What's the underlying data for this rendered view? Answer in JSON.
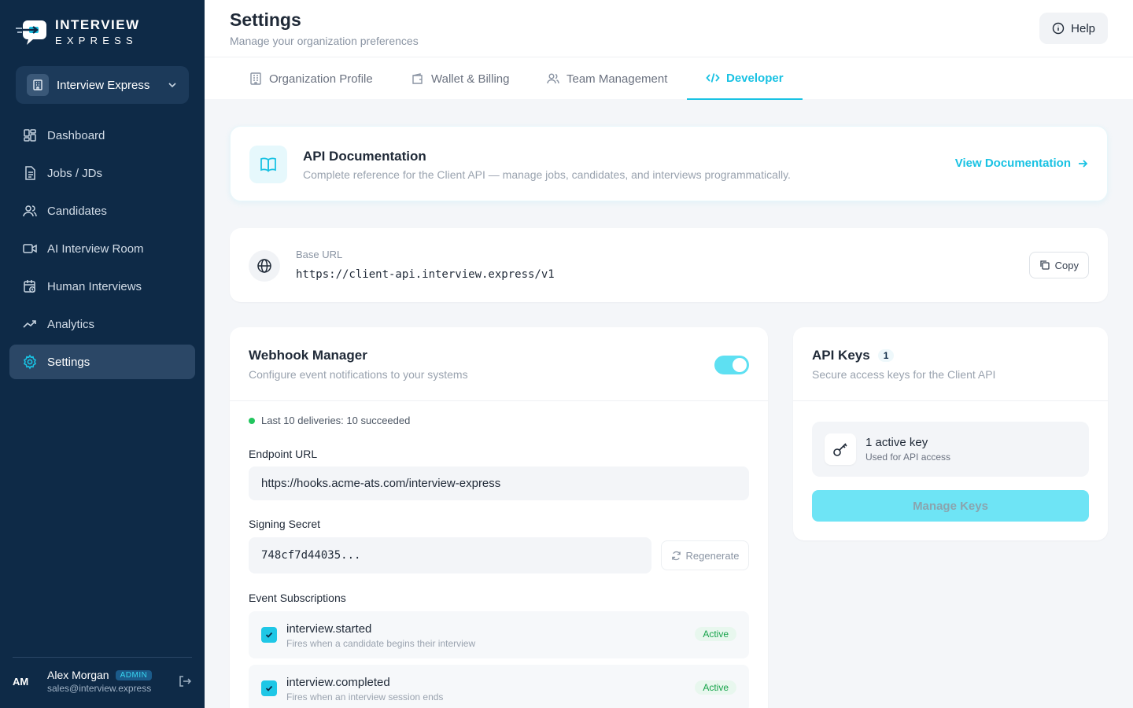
{
  "brand": {
    "line1": "INTERVIEW",
    "line2": "EXPRESS"
  },
  "org": {
    "label": "Interview Express"
  },
  "nav": [
    {
      "label": "Dashboard",
      "icon": "grid-icon"
    },
    {
      "label": "Jobs / JDs",
      "icon": "document-icon"
    },
    {
      "label": "Candidates",
      "icon": "users-icon"
    },
    {
      "label": "AI Interview Room",
      "icon": "video-icon"
    },
    {
      "label": "Human Interviews",
      "icon": "calendar-clock-icon"
    },
    {
      "label": "Analytics",
      "icon": "trend-icon"
    },
    {
      "label": "Settings",
      "icon": "gear-icon",
      "active": true
    }
  ],
  "user": {
    "initials": "AM",
    "name": "Alex Morgan",
    "role": "ADMIN",
    "email": "sales@interview.express"
  },
  "header": {
    "title": "Settings",
    "subtitle": "Manage your organization preferences",
    "help": "Help"
  },
  "tabs": [
    {
      "label": "Organization Profile"
    },
    {
      "label": "Wallet & Billing"
    },
    {
      "label": "Team Management"
    },
    {
      "label": "Developer",
      "active": true
    }
  ],
  "docs": {
    "title": "API Documentation",
    "description": "Complete reference for the Client API — manage jobs, candidates, and interviews programmatically.",
    "link": "View Documentation"
  },
  "base_url": {
    "label": "Base URL",
    "value": "https://client-api.interview.express/v1",
    "copy": "Copy"
  },
  "webhook": {
    "title": "Webhook Manager",
    "subtitle": "Configure event notifications to your systems",
    "enabled": true,
    "deliveries": "Last 10 deliveries: 10 succeeded",
    "endpoint_label": "Endpoint URL",
    "endpoint_value": "https://hooks.acme-ats.com/interview-express",
    "secret_label": "Signing Secret",
    "secret_value": "748cf7d44035...",
    "regenerate": "Regenerate",
    "events_label": "Event Subscriptions",
    "events": [
      {
        "name": "interview.started",
        "description": "Fires when a candidate begins their interview",
        "status": "Active"
      },
      {
        "name": "interview.completed",
        "description": "Fires when an interview session ends",
        "status": "Active"
      }
    ]
  },
  "api_keys": {
    "title": "API Keys",
    "count": "1",
    "subtitle": "Secure access keys for the Client API",
    "active_title": "1 active key",
    "active_sub": "Used for API access",
    "manage": "Manage Keys"
  },
  "colors": {
    "sidebar": "#0e2a47",
    "accent": "#19c2e3",
    "success": "#16a34a"
  }
}
